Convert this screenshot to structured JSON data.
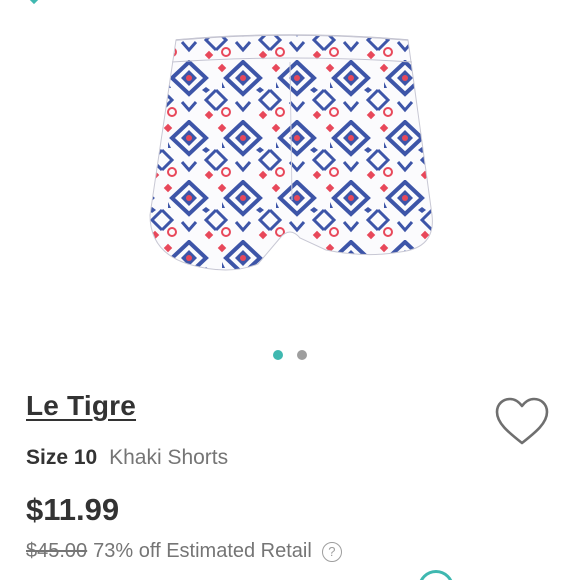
{
  "product": {
    "brand": "Le Tigre",
    "size_label": "Size",
    "size_value": "10",
    "category": "Khaki Shorts",
    "price": "$11.99",
    "original_price": "$45.00",
    "discount_text": "73% off Estimated Retail",
    "help_glyph": "?",
    "image_description_icon": "shorts-product-photo"
  },
  "carousel": {
    "total_images": 2,
    "active_index": 0
  },
  "colors": {
    "accent": "#3fb8b0",
    "text_primary": "#333333",
    "text_secondary": "#757575",
    "pattern_blue": "#3d55a8",
    "pattern_red": "#e8485a"
  },
  "icons": {
    "back": "chevron-icon",
    "like": "heart-outline-icon",
    "help": "question-circle-icon"
  }
}
